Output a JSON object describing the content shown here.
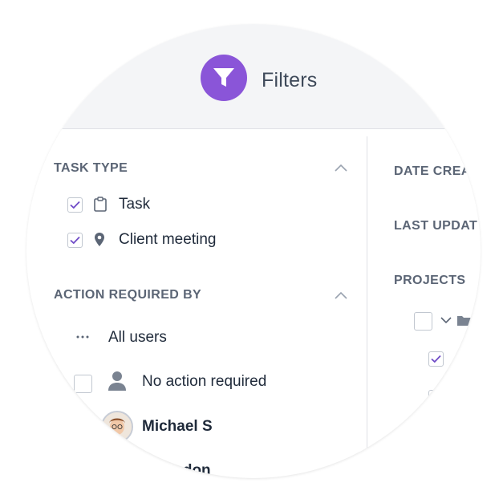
{
  "header": {
    "title": "Filters",
    "icon": "funnel-icon",
    "accent": "#8a55d8"
  },
  "left_panel": {
    "task_type": {
      "heading": "TASK TYPE",
      "items": [
        {
          "label": "Task",
          "checked": true,
          "icon": "clipboard-icon"
        },
        {
          "label": "Client meeting",
          "checked": true,
          "icon": "map-pin-icon"
        }
      ]
    },
    "action_required_by": {
      "heading": "ACTION REQUIRED BY",
      "all_users": "All users",
      "items": [
        {
          "label": "No action required",
          "checked": false,
          "icon": "user-icon"
        },
        {
          "label": "Michael S",
          "avatar": true
        },
        {
          "label": "...don",
          "partial": true
        }
      ]
    }
  },
  "right_panel": {
    "sections": [
      {
        "heading": "DATE CREA"
      },
      {
        "heading": "LAST UPDAT"
      },
      {
        "heading": "PROJECTS"
      }
    ]
  }
}
